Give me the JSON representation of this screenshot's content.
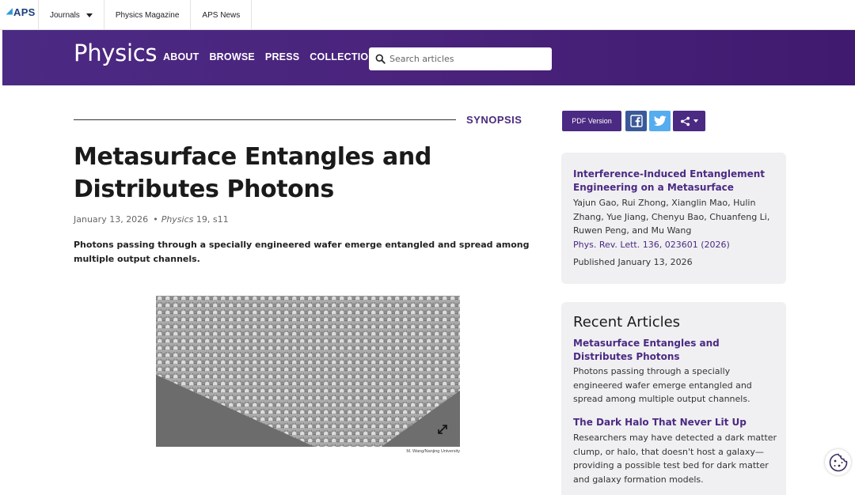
{
  "topbar": {
    "logo": "APS",
    "nav": [
      "Journals",
      "Physics Magazine",
      "APS News"
    ]
  },
  "header": {
    "logo": "Physics",
    "nav": [
      "ABOUT",
      "BROWSE",
      "PRESS",
      "COLLECTIONS"
    ],
    "search_placeholder": "Search articles"
  },
  "article": {
    "section": "SYNOPSIS",
    "title": "Metasurface Entangles and Distributes Photons",
    "date": "January 13, 2026",
    "journal": "Physics",
    "volume": "19, s11",
    "lede": "Photons passing through a specially engineered wafer emerge entangled and spread among multiple output channels.",
    "image_credit": "M. Wang/Nanjing University"
  },
  "actions": {
    "pdf_label": "PDF Version"
  },
  "source_card": {
    "title": "Interference-Induced Entanglement Engineering on a Metasurface",
    "authors": "Yajun Gao, Rui Zhong, Xianglin Mao, Hulin Zhang, Yue Jiang, Chenyu Bao, Chuanfeng Li, Ruwen Peng, and Mu Wang",
    "citation": "Phys. Rev. Lett. 136, 023601 (2026)",
    "published": "Published January 13, 2026"
  },
  "recent": {
    "heading": "Recent Articles",
    "items": [
      {
        "title": "Metasurface Entangles and Distributes Photons",
        "desc": "Photons passing through a specially engineered wafer emerge entangled and spread among multiple output channels."
      },
      {
        "title": "The Dark Halo That Never Lit Up",
        "desc": "Researchers may have detected a dark matter clump, or halo, that doesn't host a galaxy—providing a possible test bed for dark matter and galaxy formation models."
      }
    ]
  },
  "colors": {
    "brand_purple": "#4b2a83",
    "facebook": "#3b5998",
    "twitter": "#55acee"
  },
  "icons": [
    "search-icon",
    "facebook-icon",
    "twitter-icon",
    "share-icon",
    "expand-icon",
    "cookie-icon"
  ]
}
